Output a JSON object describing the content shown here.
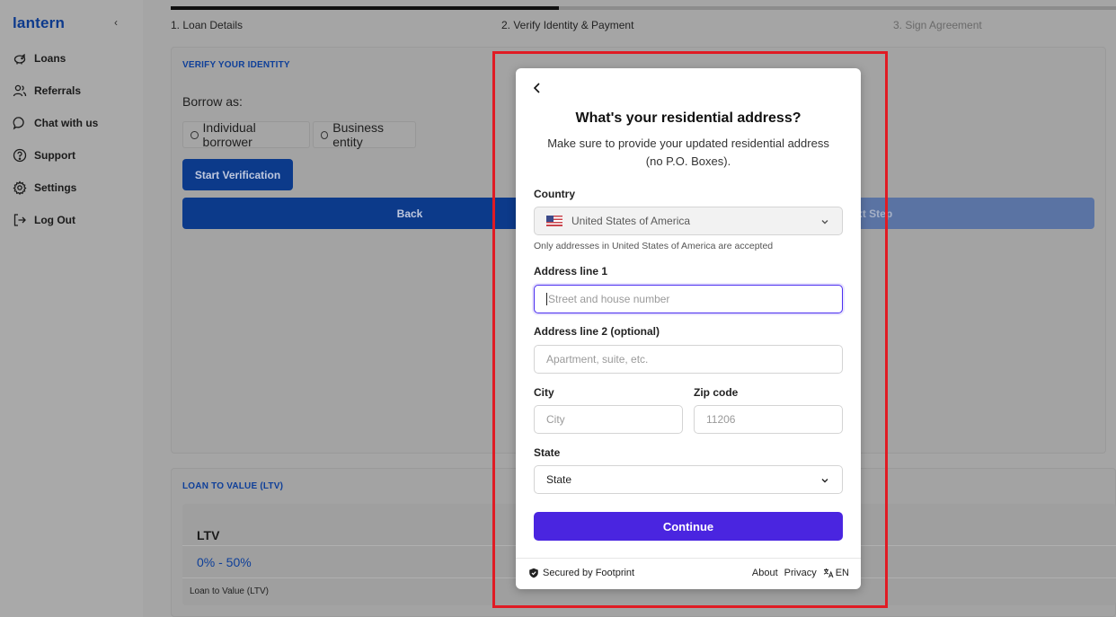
{
  "sidebar": {
    "logo": "lantern",
    "collapse_icon": "‹",
    "items": [
      {
        "label": "Loans",
        "icon": "piggy-bank-icon"
      },
      {
        "label": "Referrals",
        "icon": "users-icon"
      },
      {
        "label": "Chat with us",
        "icon": "chat-icon"
      },
      {
        "label": "Support",
        "icon": "help-circle-icon"
      },
      {
        "label": "Settings",
        "icon": "gear-icon"
      },
      {
        "label": "Log Out",
        "icon": "logout-icon"
      }
    ]
  },
  "steps": {
    "step1": "1. Loan Details",
    "step2": "2. Verify Identity & Payment",
    "step3": "3. Sign Agreement",
    "progress_fraction": 0.41
  },
  "verify": {
    "title": "VERIFY YOUR IDENTITY",
    "borrow_label": "Borrow as:",
    "option_individual": "Individual borrower",
    "option_business": "Business entity",
    "start_button": "Start Verification",
    "back_button": "Back",
    "next_button": "Next Step"
  },
  "ltv": {
    "title": "LOAN TO VALUE (LTV)",
    "label": "LTV",
    "value": "0% - 50%",
    "sub": "Loan to Value (LTV)"
  },
  "modal": {
    "title": "What's your residential address?",
    "subtitle": "Make sure to provide your updated residential address (no P.O. Boxes).",
    "country_label": "Country",
    "country_value": "United States of America",
    "country_hint": "Only addresses in United States of America are accepted",
    "address1_label": "Address line 1",
    "address1_placeholder": "Street and house number",
    "address2_label": "Address line 2 (optional)",
    "address2_placeholder": "Apartment, suite, etc.",
    "city_label": "City",
    "city_placeholder": "City",
    "zip_label": "Zip code",
    "zip_placeholder": "11206",
    "state_label": "State",
    "state_value": "State",
    "continue_button": "Continue",
    "footer": {
      "secured": "Secured by Footprint",
      "about": "About",
      "privacy": "Privacy",
      "language": "EN"
    }
  },
  "colors": {
    "brand_blue": "#0e3f99",
    "continue_purple": "#4a25e0",
    "highlight_red": "#e01b24"
  }
}
